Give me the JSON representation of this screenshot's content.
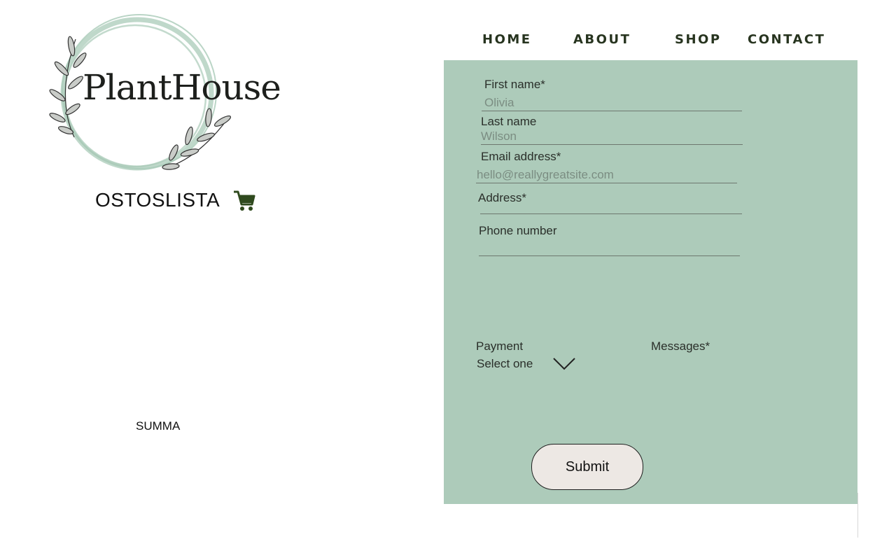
{
  "brand": {
    "name": "PlantHouse"
  },
  "nav": {
    "items": [
      "HOME",
      "ABOUT",
      "SHOP",
      "CONTACT"
    ]
  },
  "cart": {
    "title": "OSTOSLISTA",
    "icon": "shopping-cart-icon",
    "summary_label": "SUMMA"
  },
  "form": {
    "first_name": {
      "label": "First name*",
      "placeholder": "Olivia"
    },
    "last_name": {
      "label": "Last name",
      "placeholder": "Wilson"
    },
    "email": {
      "label": "Email address*",
      "placeholder": "hello@reallygreatsite.com"
    },
    "address": {
      "label": "Address*",
      "placeholder": ""
    },
    "phone": {
      "label": "Phone number",
      "placeholder": ""
    },
    "payment": {
      "label": "Payment",
      "value": "Select one"
    },
    "messages": {
      "label": "Messages*"
    },
    "submit_label": "Submit"
  },
  "colors": {
    "panel": "#adcbba",
    "nav_text": "#27341f",
    "button_bg": "#ede8e4",
    "cart_icon": "#2f4a1e"
  }
}
